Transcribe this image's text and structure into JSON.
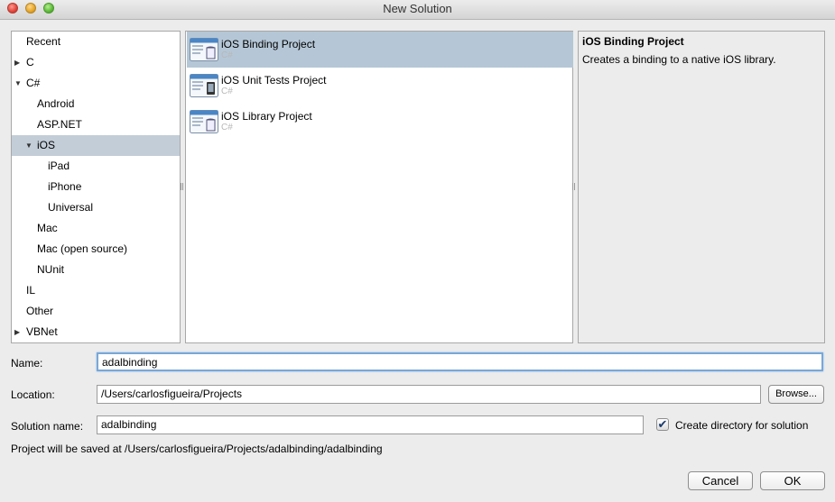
{
  "window": {
    "title": "New Solution"
  },
  "categories": [
    {
      "label": "Recent",
      "expander": "",
      "selected": false
    },
    {
      "label": "C",
      "expander": "collapsed",
      "selected": false
    },
    {
      "label": "C#",
      "expander": "expanded",
      "selected": false
    },
    {
      "label": "Android",
      "expander": "",
      "selected": false
    },
    {
      "label": "ASP.NET",
      "expander": "",
      "selected": false
    },
    {
      "label": "iOS",
      "expander": "expanded",
      "selected": true
    },
    {
      "label": "iPad",
      "expander": "",
      "selected": false
    },
    {
      "label": "iPhone",
      "expander": "",
      "selected": false
    },
    {
      "label": "Universal",
      "expander": "",
      "selected": false
    },
    {
      "label": "Mac",
      "expander": "",
      "selected": false
    },
    {
      "label": "Mac (open source)",
      "expander": "",
      "selected": false
    },
    {
      "label": "NUnit",
      "expander": "",
      "selected": false
    },
    {
      "label": "IL",
      "expander": "",
      "selected": false
    },
    {
      "label": "Other",
      "expander": "",
      "selected": false
    },
    {
      "label": "VBNet",
      "expander": "collapsed",
      "selected": false
    }
  ],
  "templates": [
    {
      "title": "iOS Binding Project",
      "language": "C#",
      "icon": "binding-project-icon",
      "selected": true
    },
    {
      "title": "iOS Unit Tests Project",
      "language": "C#",
      "icon": "unit-tests-project-icon",
      "selected": false
    },
    {
      "title": "iOS Library Project",
      "language": "C#",
      "icon": "library-project-icon",
      "selected": false
    }
  ],
  "description": {
    "title": "iOS Binding Project",
    "text": "Creates a binding to a native iOS library."
  },
  "form": {
    "name_label": "Name:",
    "name_value": "adalbinding",
    "location_label": "Location:",
    "location_value": "/Users/carlosfigueira/Projects",
    "browse_label": "Browse...",
    "solution_label": "Solution name:",
    "solution_value": "adalbinding",
    "create_dir_label": "Create directory for solution",
    "create_dir_checked": true,
    "save_path_text": "Project will be saved at /Users/carlosfigueira/Projects/adalbinding/adalbinding"
  },
  "buttons": {
    "cancel_label": "Cancel",
    "ok_label": "OK"
  },
  "colors": {
    "selection_category": "#c3cdd7",
    "selection_template": "#b5c7d6",
    "focus_ring": "#79a7d8"
  }
}
